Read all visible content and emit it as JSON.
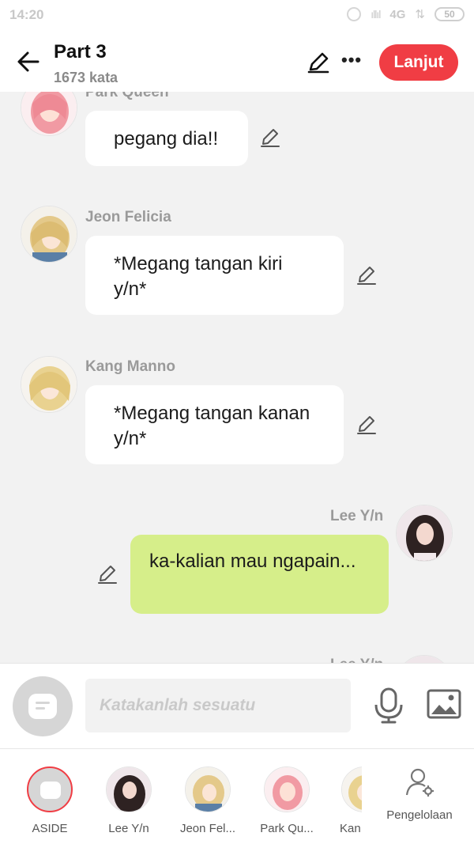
{
  "status_bar": {
    "time": "14:20",
    "network": "4G",
    "battery": "50"
  },
  "header": {
    "title": "Part 3",
    "word_count": "1673 kata",
    "next_label": "Lanjut"
  },
  "messages": [
    {
      "sender": "Park Queen",
      "text": "pegang dia!!",
      "side": "left"
    },
    {
      "sender": "Jeon Felicia",
      "text": "*Megang tangan kiri y/n*",
      "side": "left"
    },
    {
      "sender": "Kang Manno",
      "text": "*Megang tangan kanan y/n*",
      "side": "left"
    },
    {
      "sender": "Lee Y/n",
      "text": "ka-kalian mau ngapain...",
      "side": "right"
    },
    {
      "sender": "Lee Y/n",
      "text": "",
      "side": "right"
    }
  ],
  "input": {
    "placeholder": "Katakanlah sesuatu"
  },
  "characters": [
    {
      "label": "ASIDE"
    },
    {
      "label": "Lee Y/n"
    },
    {
      "label": "Jeon Fel..."
    },
    {
      "label": "Park Qu..."
    },
    {
      "label": "Kan"
    }
  ],
  "management_label": "Pengelolaan",
  "colors": {
    "accent": "#f03d44",
    "user_bubble": "#d6ee8a",
    "bubble": "#ffffff",
    "background": "#f2f2f2"
  }
}
